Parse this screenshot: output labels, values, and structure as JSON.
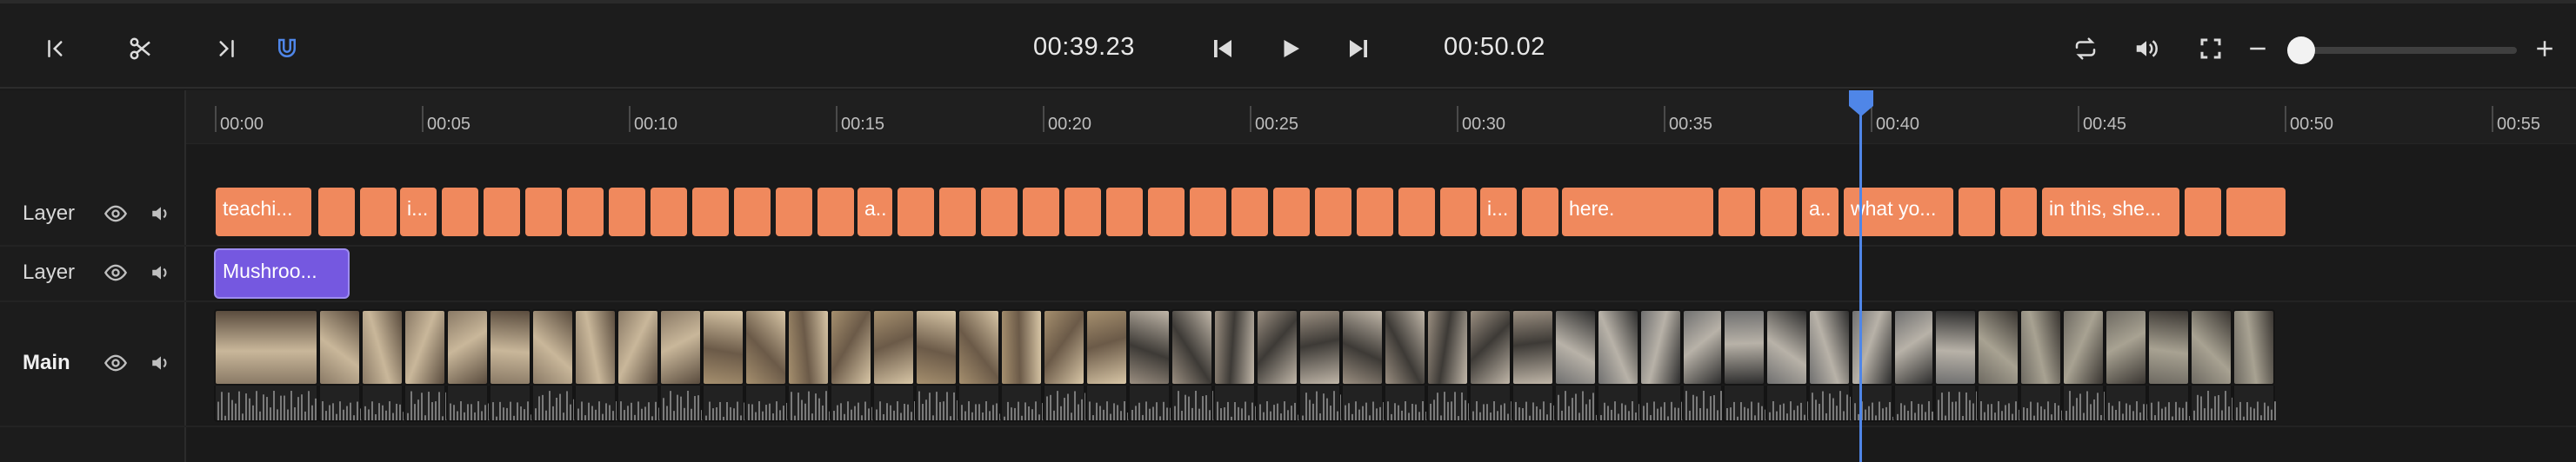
{
  "toolbar": {
    "current_time": "00:39.23",
    "total_time": "00:50.02"
  },
  "ruler": {
    "labels": [
      "00:00",
      "00:05",
      "00:10",
      "00:15",
      "00:20",
      "00:25",
      "00:30",
      "00:35",
      "00:40",
      "00:45",
      "00:50",
      "00:55"
    ]
  },
  "tracks": [
    {
      "name": "Layer"
    },
    {
      "name": "Layer"
    },
    {
      "name": "Main"
    }
  ],
  "caption_clips": [
    "teachi...",
    "i...",
    "a..",
    "i...",
    "here.",
    "a..",
    "what yo...",
    "in this, she..."
  ],
  "audio_clip": "Mushroo...",
  "colors": {
    "caption_clip": "#f0895d",
    "audio_clip": "#7558e0",
    "playhead": "#4f86e8",
    "magnet_active": "#4f86e8"
  },
  "playhead_time_seconds": 39.23
}
